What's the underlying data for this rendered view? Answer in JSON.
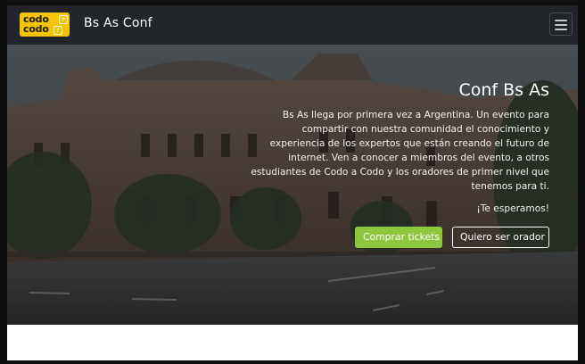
{
  "navbar": {
    "logo": {
      "line1": "codo",
      "line2": "codo",
      "brand_color": "#f5c400"
    },
    "brand_text": "Bs As Conf",
    "menu_icon": "hamburger-icon",
    "background": "#212529"
  },
  "hero": {
    "title": "Conf Bs As",
    "description_lines": [
      "Bs As llega por primera vez a Argentina. Un evento para",
      "compartir con nuestra comunidad el conocimiento y",
      "experiencia de los expertos que están creando el futuro de",
      "internet. Ven a conocer a miembros del evento, a otros",
      "estudiantes de Codo a Codo y los oradores de primer nivel que",
      "tenemos para ti."
    ],
    "tagline": "¡Te esperamos!",
    "primary_button": "Comprar tickets",
    "secondary_button": "Quiero ser orador",
    "primary_color": "#8dc63f"
  }
}
